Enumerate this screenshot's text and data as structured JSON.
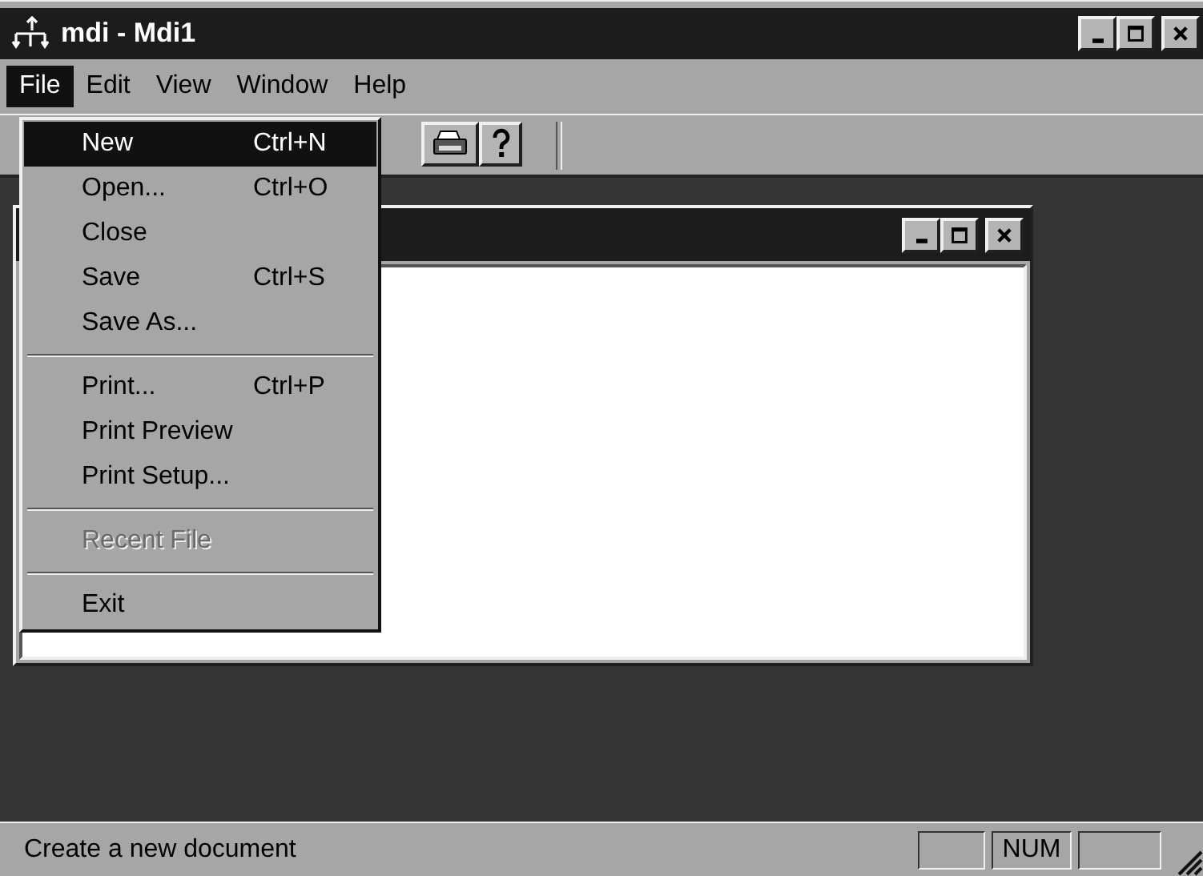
{
  "window": {
    "title": "mdi - Mdi1"
  },
  "menu_bar": [
    {
      "label": "File",
      "selected": true
    },
    {
      "label": "Edit",
      "selected": false
    },
    {
      "label": "View",
      "selected": false
    },
    {
      "label": "Window",
      "selected": false
    },
    {
      "label": "Help",
      "selected": false
    }
  ],
  "file_menu": {
    "items": [
      {
        "kind": "item",
        "label": "New",
        "shortcut": "Ctrl+N",
        "selected": true,
        "disabled": false
      },
      {
        "kind": "item",
        "label": "Open...",
        "shortcut": "Ctrl+O",
        "selected": false,
        "disabled": false
      },
      {
        "kind": "item",
        "label": "Close",
        "selected": false,
        "disabled": false
      },
      {
        "kind": "item",
        "label": "Save",
        "shortcut": "Ctrl+S",
        "selected": false,
        "disabled": false
      },
      {
        "kind": "item",
        "label": "Save As...",
        "selected": false,
        "disabled": false
      },
      {
        "kind": "separator"
      },
      {
        "kind": "item",
        "label": "Print...",
        "shortcut": "Ctrl+P",
        "selected": false,
        "disabled": false
      },
      {
        "kind": "item",
        "label": "Print Preview",
        "selected": false,
        "disabled": false
      },
      {
        "kind": "item",
        "label": "Print Setup...",
        "selected": false,
        "disabled": false
      },
      {
        "kind": "separator"
      },
      {
        "kind": "item",
        "label": "Recent File",
        "selected": false,
        "disabled": true
      },
      {
        "kind": "separator"
      },
      {
        "kind": "item",
        "label": "Exit",
        "selected": false,
        "disabled": false
      }
    ]
  },
  "toolbar": {
    "buttons": [
      {
        "kind": "print"
      },
      {
        "kind": "help"
      }
    ]
  },
  "status_bar": {
    "message": "Create a new document",
    "panels": [
      {
        "kind": "empty"
      },
      {
        "kind": "text",
        "text": "NUM"
      },
      {
        "kind": "empty"
      }
    ]
  }
}
